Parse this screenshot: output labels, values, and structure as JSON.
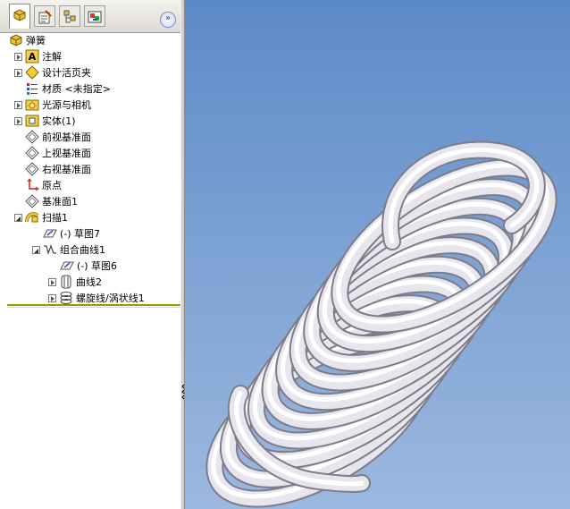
{
  "feature_tree": {
    "tabs": [
      "feature-manager-icon",
      "property-manager-icon",
      "configuration-manager-icon",
      "display-manager-icon"
    ],
    "collapse_label": "»",
    "root": {
      "label": "弹簧",
      "icon": "part-icon"
    },
    "items": [
      {
        "label": "注解",
        "icon": "annotation-icon"
      },
      {
        "label": "设计活页夹",
        "icon": "design-binder-icon"
      },
      {
        "label": "材质 <未指定>",
        "icon": "material-icon"
      },
      {
        "label": "光源与相机",
        "icon": "lights-cameras-icon"
      },
      {
        "label": "实体(1)",
        "icon": "solid-bodies-icon"
      },
      {
        "label": "前视基准面",
        "icon": "plane-icon"
      },
      {
        "label": "上视基准面",
        "icon": "plane-icon"
      },
      {
        "label": "右视基准面",
        "icon": "plane-icon"
      },
      {
        "label": "原点",
        "icon": "origin-icon"
      },
      {
        "label": "基准面1",
        "icon": "plane-icon"
      },
      {
        "label": "扫描1",
        "icon": "sweep-icon"
      },
      {
        "label": "(-) 草图7",
        "icon": "sketch-icon"
      },
      {
        "label": "组合曲线1",
        "icon": "composite-curve-icon"
      },
      {
        "label": "(-) 草图6",
        "icon": "sketch-icon"
      },
      {
        "label": "曲线2",
        "icon": "curve-icon"
      },
      {
        "label": "螺旋线/涡状线1",
        "icon": "helix-icon"
      }
    ]
  },
  "viewport": {
    "model": "spring-3d-model",
    "background_top": "#5c8ac8",
    "background_bottom": "#9cb8e0"
  }
}
